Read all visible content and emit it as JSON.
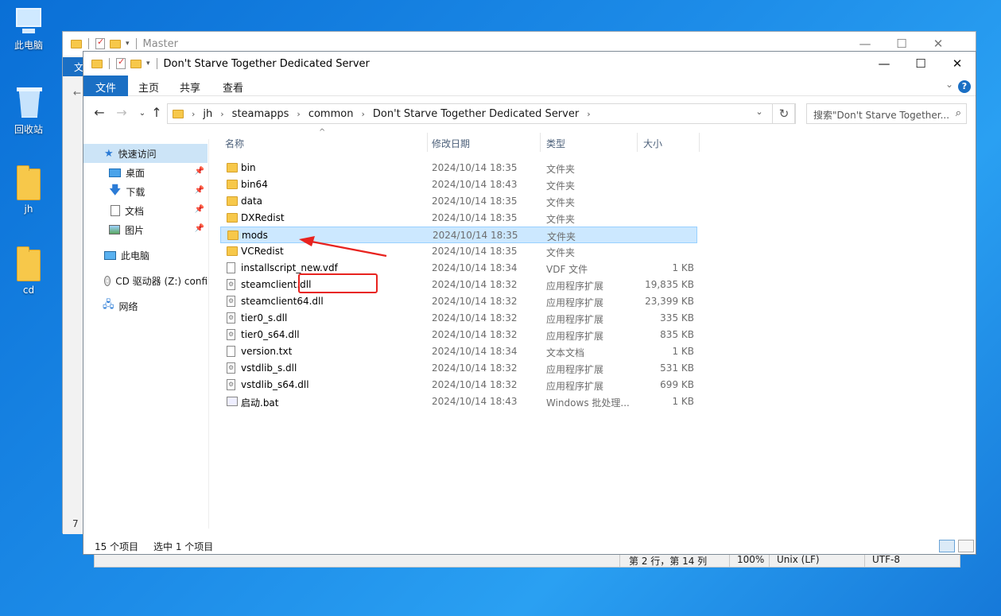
{
  "desktop": {
    "icons": [
      {
        "label": "此电脑"
      },
      {
        "label": "回收站"
      },
      {
        "label": "jh"
      },
      {
        "label": "cd"
      }
    ]
  },
  "back_window": {
    "title": "Master",
    "tab_fragment": "文",
    "fragment_1": "7",
    "status": {
      "position": "第 2 行，第 14 列",
      "zoom": "100%",
      "line_ending": "Unix (LF)",
      "encoding": "UTF-8"
    }
  },
  "window": {
    "title": "Don't Starve Together Dedicated Server",
    "ribbon_tabs": [
      "文件",
      "主页",
      "共享",
      "查看"
    ],
    "help": "?",
    "breadcrumb": [
      "jh",
      "steamapps",
      "common",
      "Don't Starve Together Dedicated Server"
    ],
    "search_placeholder": "搜索\"Don't Starve Together...",
    "nav": {
      "quick_access": "快速访问",
      "desktop": "桌面",
      "downloads": "下载",
      "documents": "文档",
      "pictures": "图片",
      "this_pc": "此电脑",
      "cd_drive": "CD 驱动器 (Z:) confi",
      "network": "网络"
    },
    "columns": {
      "name": "名称",
      "date": "修改日期",
      "type": "类型",
      "size": "大小"
    },
    "files": [
      {
        "name": "bin",
        "date": "2024/10/14 18:35",
        "type": "文件夹",
        "size": "",
        "kind": "folder"
      },
      {
        "name": "bin64",
        "date": "2024/10/14 18:43",
        "type": "文件夹",
        "size": "",
        "kind": "folder"
      },
      {
        "name": "data",
        "date": "2024/10/14 18:35",
        "type": "文件夹",
        "size": "",
        "kind": "folder"
      },
      {
        "name": "DXRedist",
        "date": "2024/10/14 18:35",
        "type": "文件夹",
        "size": "",
        "kind": "folder"
      },
      {
        "name": "mods",
        "date": "2024/10/14 18:35",
        "type": "文件夹",
        "size": "",
        "kind": "folder",
        "selected": true
      },
      {
        "name": "VCRedist",
        "date": "2024/10/14 18:35",
        "type": "文件夹",
        "size": "",
        "kind": "folder"
      },
      {
        "name": "installscript_new.vdf",
        "date": "2024/10/14 18:34",
        "type": "VDF 文件",
        "size": "1 KB",
        "kind": "doc"
      },
      {
        "name": "steamclient.dll",
        "date": "2024/10/14 18:32",
        "type": "应用程序扩展",
        "size": "19,835 KB",
        "kind": "dll"
      },
      {
        "name": "steamclient64.dll",
        "date": "2024/10/14 18:32",
        "type": "应用程序扩展",
        "size": "23,399 KB",
        "kind": "dll"
      },
      {
        "name": "tier0_s.dll",
        "date": "2024/10/14 18:32",
        "type": "应用程序扩展",
        "size": "335 KB",
        "kind": "dll"
      },
      {
        "name": "tier0_s64.dll",
        "date": "2024/10/14 18:32",
        "type": "应用程序扩展",
        "size": "835 KB",
        "kind": "dll"
      },
      {
        "name": "version.txt",
        "date": "2024/10/14 18:34",
        "type": "文本文档",
        "size": "1 KB",
        "kind": "doc"
      },
      {
        "name": "vstdlib_s.dll",
        "date": "2024/10/14 18:32",
        "type": "应用程序扩展",
        "size": "531 KB",
        "kind": "dll"
      },
      {
        "name": "vstdlib_s64.dll",
        "date": "2024/10/14 18:32",
        "type": "应用程序扩展",
        "size": "699 KB",
        "kind": "dll"
      },
      {
        "name": "启动.bat",
        "date": "2024/10/14 18:43",
        "type": "Windows 批处理...",
        "size": "1 KB",
        "kind": "bat"
      }
    ],
    "status": {
      "item_count": "15 个项目",
      "selected": "选中 1 个项目"
    }
  },
  "colors": {
    "accent": "#1a6fc4",
    "selection": "#cce8ff",
    "annotation": "#e8231f"
  }
}
